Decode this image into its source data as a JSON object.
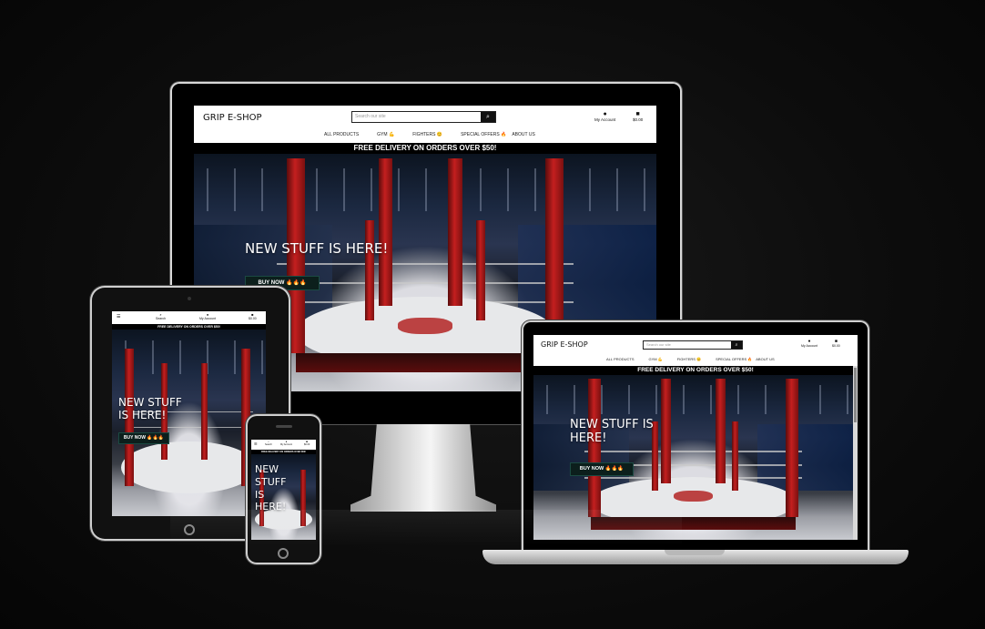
{
  "site": {
    "logo": "GRIP E-SHOP",
    "search_placeholder": "Search our site",
    "search_icon": "search-icon",
    "account_label": "My Account",
    "bag_total": "$0.00",
    "search_label": "Search",
    "nav": [
      "ALL PRODUCTS",
      "GYM 💪",
      "FIGHTERS 😊",
      "SPECIAL OFFERS 🔥",
      "ABOUT US"
    ],
    "banner": "FREE DELIVERY ON ORDERS OVER $50!",
    "hero_title": "NEW STUFF IS HERE!",
    "buy_button": "BUY NOW 🔥🔥🔥"
  },
  "tablet": {
    "hero_title_line1": "NEW STUFF",
    "hero_title_line2": "IS HERE!"
  },
  "phone": {
    "hero_title_line1": "NEW",
    "hero_title_line2": "STUFF",
    "hero_title_line3": "IS",
    "hero_title_line4": "HERE!"
  },
  "laptop": {
    "hero_title_line1": "NEW STUFF IS",
    "hero_title_line2": "HERE!"
  },
  "colors": {
    "background": "#0d0d0d",
    "banner": "#000000",
    "buy_button": "#0c1f1c",
    "ring_red": "#c41f1f"
  }
}
